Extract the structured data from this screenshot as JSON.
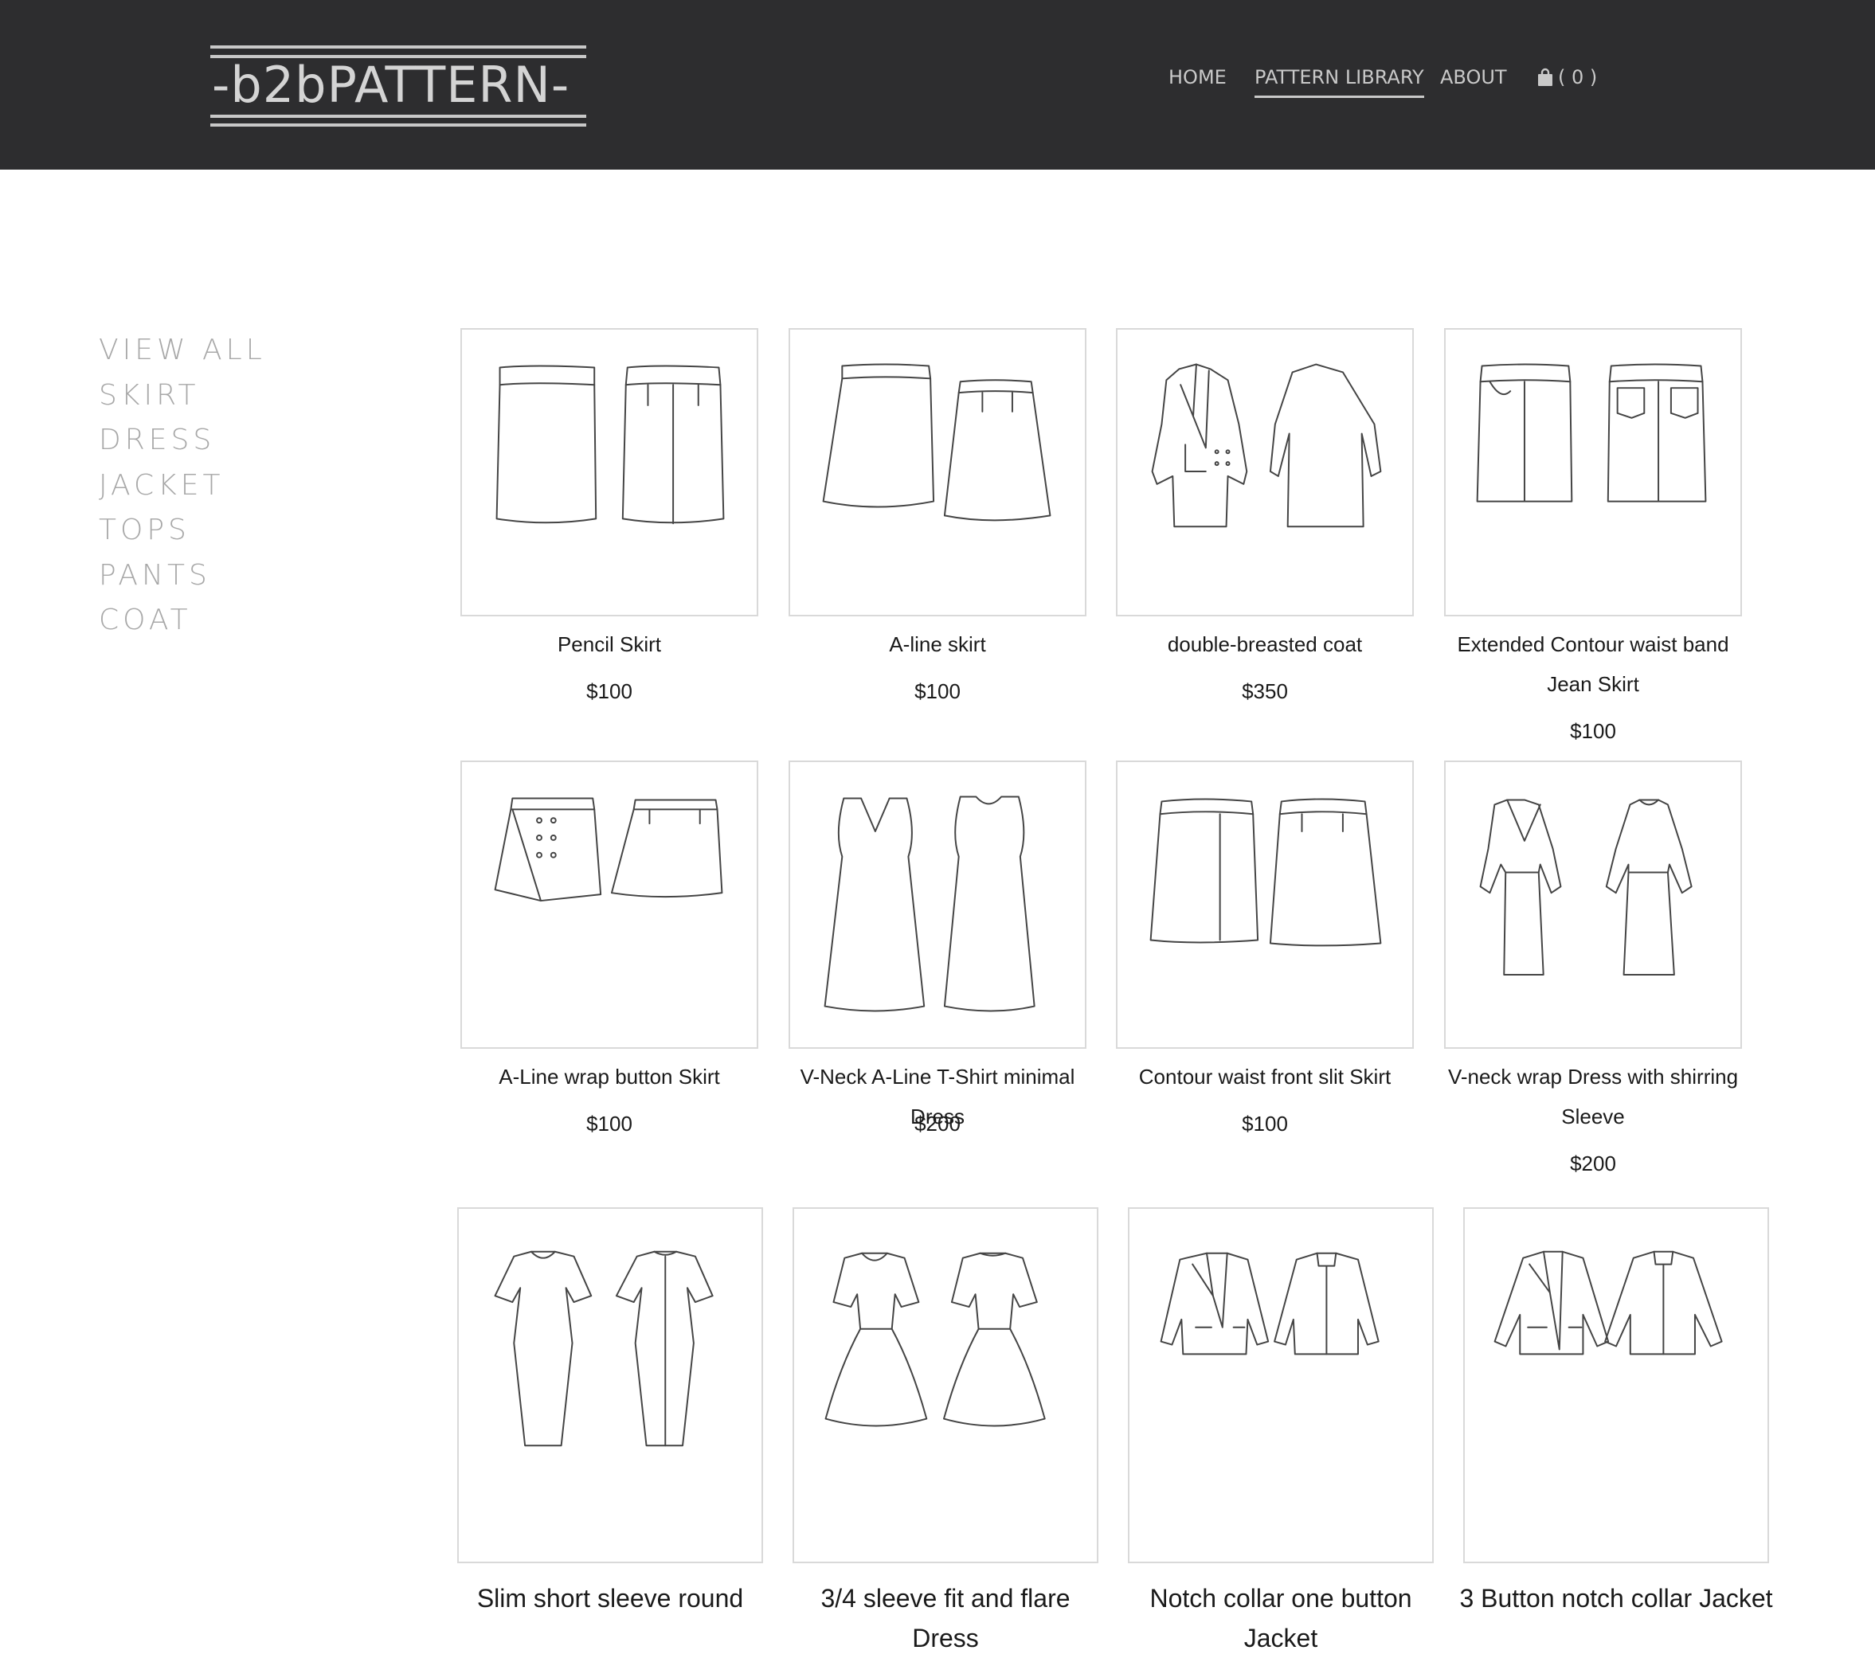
{
  "header": {
    "logo_text": "-b2bPATTERN-",
    "nav": [
      {
        "label": "HOME",
        "active": false
      },
      {
        "label": "PATTERN LIBRARY",
        "active": true
      },
      {
        "label": "ABOUT",
        "active": false
      }
    ],
    "cart_label": "( 0 )"
  },
  "sidebar": {
    "items": [
      "VIEW ALL",
      "SKIRT",
      "DRESS",
      "JACKET",
      "TOPS",
      "PANTS",
      "COAT"
    ]
  },
  "products": [
    {
      "title": "Pencil Skirt",
      "price": "$100",
      "icon": "pencil-skirt-sketch"
    },
    {
      "title": "A-line skirt",
      "price": "$100",
      "icon": "a-line-skirt-sketch"
    },
    {
      "title": "double-breasted coat",
      "price": "$350",
      "icon": "coat-sketch"
    },
    {
      "title": "Extended Contour waist band Jean Skirt",
      "price": "$100",
      "icon": "jean-skirt-sketch"
    },
    {
      "title": "A-Line wrap button Skirt",
      "price": "$100",
      "icon": "wrap-skirt-sketch"
    },
    {
      "title": "V-Neck A-Line T-Shirt minimal Dress",
      "price": "$200",
      "icon": "v-neck-dress-sketch"
    },
    {
      "title": "Contour waist front slit Skirt",
      "price": "$100",
      "icon": "slit-skirt-sketch"
    },
    {
      "title": "V-neck wrap Dress with shirring Sleeve",
      "price": "$200",
      "icon": "wrap-dress-sketch"
    },
    {
      "title": "Slim short sleeve round",
      "price": "",
      "icon": "sheath-dress-sketch"
    },
    {
      "title": "3/4 sleeve fit and flare Dress",
      "price": "",
      "icon": "flare-dress-sketch"
    },
    {
      "title": "Notch collar one button Jacket",
      "price": "",
      "icon": "jacket-sketch"
    },
    {
      "title": "3 Button notch collar Jacket",
      "price": "",
      "icon": "jacket-sketch"
    }
  ]
}
